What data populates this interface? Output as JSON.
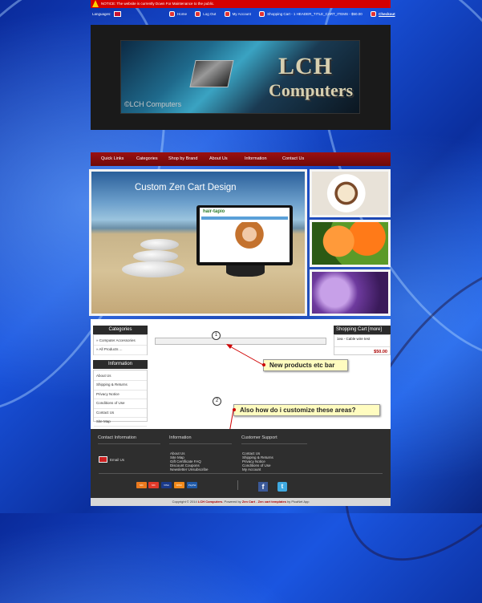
{
  "notice": {
    "text": "NOTICE: The website is currently Down For Maintenance to the public."
  },
  "topnav": {
    "languages_label": "Languages:",
    "home": "Home",
    "logout": "Log Out",
    "account": "My Account",
    "cart": "Shopping Cart - 1 HEADER_TITLE_CART_ITEMS - $50.00",
    "checkout": "Checkout"
  },
  "header": {
    "logo_line1": "LCH",
    "logo_line2": "Computers",
    "watermark": "©LCH Computers"
  },
  "menu": {
    "items": [
      "Quick Links",
      "Categories",
      "Shop by Brand",
      "About Us",
      "Information",
      "Contact Us"
    ]
  },
  "slider": {
    "title": "Custom Zen Cart Design",
    "screen_logo": "hair-tapio"
  },
  "categories": {
    "heading": "Categories",
    "items": [
      "» Computer Accessories",
      "» All Products ..."
    ]
  },
  "information": {
    "heading": "Information",
    "items": [
      "About Us",
      "Shipping & Returns",
      "Privacy Notice",
      "Conditions of Use",
      "Contact Us",
      "Site Map"
    ]
  },
  "cart_box": {
    "heading": "Shopping Cart  [more]",
    "item": "1ea - Cable wire test",
    "total": "$50.00"
  },
  "annotations": {
    "num1": "1",
    "num2": "2",
    "callout1": "New products etc bar",
    "callout2": "Also how do i customize these areas?"
  },
  "footer": {
    "contact_heading": "Contact Information",
    "info_heading": "Information",
    "support_heading": "Customer Support",
    "email_label": "Email Us",
    "info_links": [
      "About Us",
      "Site Map",
      "Gift Certificate FAQ",
      "Discount Coupons",
      "Newsletter Unsubscribe"
    ],
    "support_links": [
      "Contact Us",
      "Shipping & Returns",
      "Privacy Notice",
      "Conditions of Use",
      "My Account"
    ],
    "cards": [
      "MC",
      "MC",
      "VISA",
      "DISC",
      "PayPal"
    ],
    "facebook": "f",
    "twitter": "t"
  },
  "copyright": {
    "prefix": "Copyright © 2014",
    "brand": "LCH Computers",
    "powered": ". Powered by",
    "zencart": "Zen Cart",
    "dash": " - ",
    "templates": "Zen cart templates",
    "by": " by PicaNet App"
  }
}
